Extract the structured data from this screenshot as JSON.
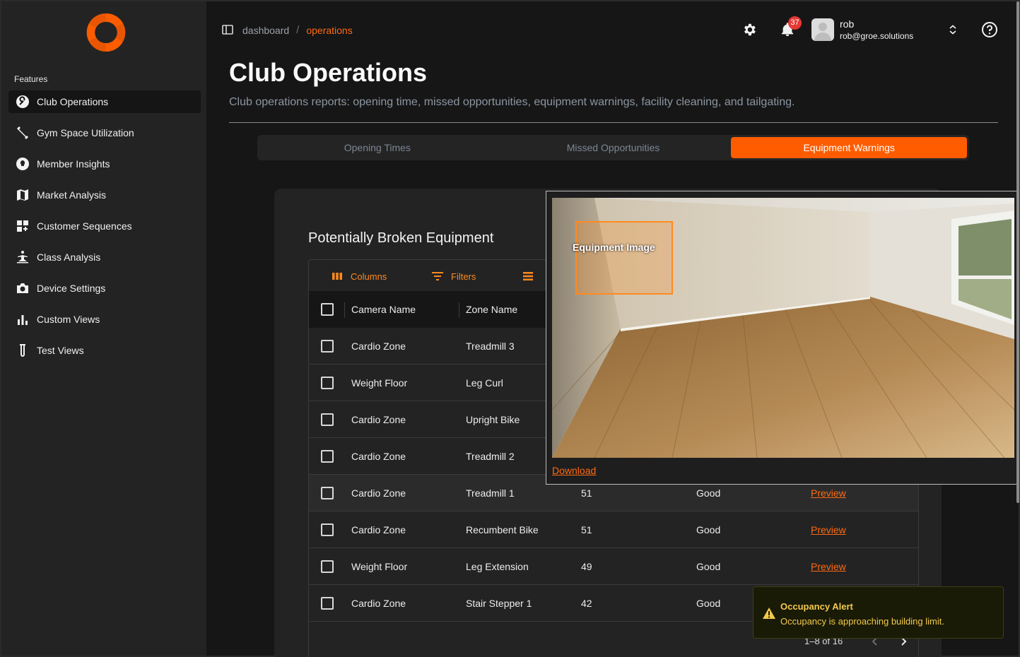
{
  "sidebar": {
    "section_label": "Features",
    "items": [
      {
        "label": "Club Operations",
        "icon": "wrench-icon",
        "active": true
      },
      {
        "label": "Gym Space Utilization",
        "icon": "dumbbell-icon"
      },
      {
        "label": "Member Insights",
        "icon": "lightbulb-icon"
      },
      {
        "label": "Market Analysis",
        "icon": "map-icon"
      },
      {
        "label": "Customer Sequences",
        "icon": "dashboard-add-icon"
      },
      {
        "label": "Class Analysis",
        "icon": "yoga-icon"
      },
      {
        "label": "Device Settings",
        "icon": "camera-icon"
      },
      {
        "label": "Custom Views",
        "icon": "bar-chart-icon"
      },
      {
        "label": "Test Views",
        "icon": "test-tube-icon"
      }
    ]
  },
  "header": {
    "breadcrumb_root": "dashboard",
    "breadcrumb_sep": "/",
    "breadcrumb_current": "operations",
    "notification_count": "37",
    "user_name": "rob",
    "user_email": "rob@groe.solutions"
  },
  "page": {
    "title": "Club Operations",
    "subtitle": "Club operations reports: opening time, missed opportunities, equipment warnings, facility cleaning, and tailgating."
  },
  "tabs": [
    {
      "label": "Opening Times"
    },
    {
      "label": "Missed Opportunities"
    },
    {
      "label": "Equipment Warnings",
      "active": true
    }
  ],
  "card": {
    "title": "Potentially Broken Equipment",
    "toolbar": {
      "columns": "Columns",
      "filters": "Filters"
    },
    "headers": {
      "camera": "Camera Name",
      "zone": "Zone Name"
    },
    "rows": [
      {
        "camera": "Cardio Zone",
        "zone": "Treadmill 3"
      },
      {
        "camera": "Weight Floor",
        "zone": "Leg Curl"
      },
      {
        "camera": "Cardio Zone",
        "zone": "Upright Bike"
      },
      {
        "camera": "Cardio Zone",
        "zone": "Treadmill 2"
      },
      {
        "camera": "Cardio Zone",
        "zone": "Treadmill 1",
        "score": "51",
        "status": "Good",
        "action": "Preview"
      },
      {
        "camera": "Cardio Zone",
        "zone": "Recumbent Bike",
        "score": "51",
        "status": "Good",
        "action": "Preview"
      },
      {
        "camera": "Weight Floor",
        "zone": "Leg Extension",
        "score": "49",
        "status": "Good",
        "action": "Preview"
      },
      {
        "camera": "Cardio Zone",
        "zone": "Stair Stepper 1",
        "score": "42",
        "status": "Good"
      }
    ],
    "pagination": "1–8 of 16"
  },
  "popup": {
    "bbox_label": "Equipment Image",
    "download_label": "Download"
  },
  "toast": {
    "title": "Occupancy Alert",
    "message": "Occupancy is approaching building limit."
  },
  "colors": {
    "accent": "#ff5c00",
    "link": "#ff6a13",
    "warning": "#f2c94c"
  }
}
